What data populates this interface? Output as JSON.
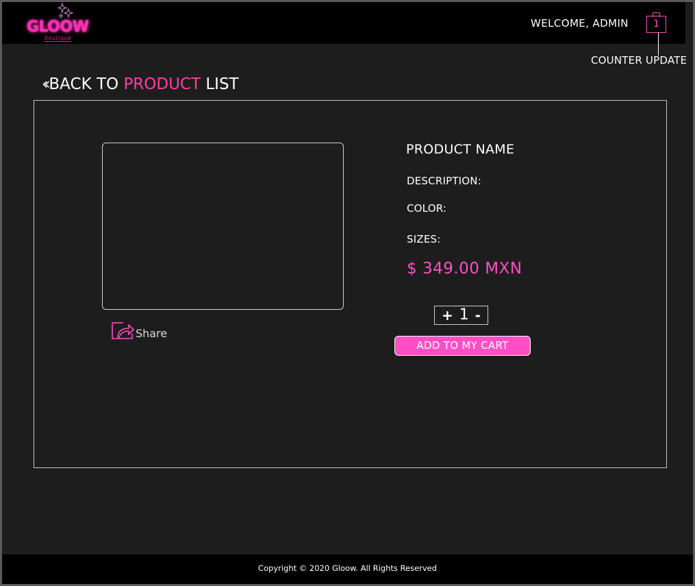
{
  "header": {
    "logo_text": "GLOOW",
    "logo_subtext": "boutique",
    "welcome": "WELCOME, ADMIN",
    "cart_count": "1",
    "counter_note": "COUNTER UPDATE"
  },
  "back_link": {
    "prefix": "BACK TO ",
    "accent": "PRODUCT",
    "suffix": " LIST"
  },
  "product": {
    "name": "PRODUCT NAME",
    "description_label": "DESCRIPTION:",
    "color_label": "COLOR:",
    "sizes_label": "SIZES:",
    "price": "$ 349.00 MXN",
    "share_label": "Share"
  },
  "quantity": {
    "plus": "+",
    "value": "1",
    "minus": "-"
  },
  "actions": {
    "add_to_cart": "ADD TO MY CART"
  },
  "footer": {
    "copyright": "Copyright © 2020 Gloow. All Rights Reserved"
  },
  "colors": {
    "accent": "#ff4fc4",
    "background": "#1e1d1e",
    "header": "#000000"
  }
}
